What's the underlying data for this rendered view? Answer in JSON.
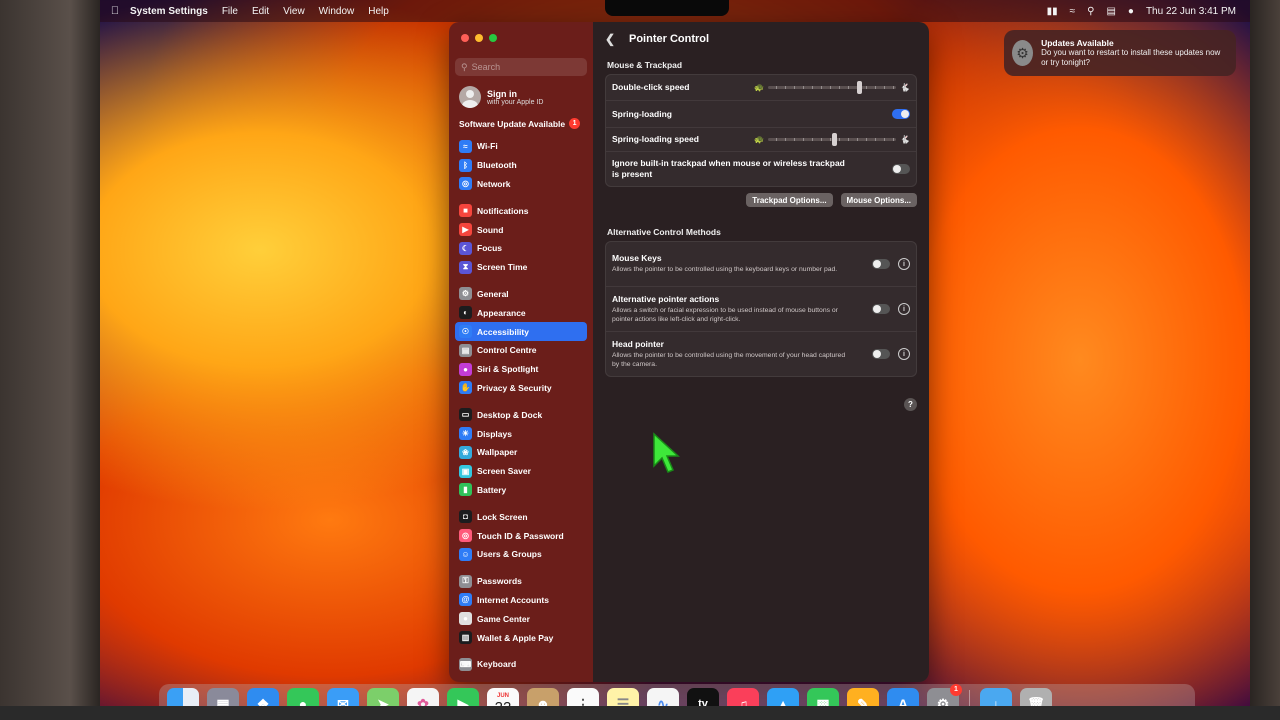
{
  "menubar": {
    "app_name": "System Settings",
    "menus": [
      "File",
      "Edit",
      "View",
      "Window",
      "Help"
    ],
    "datetime": "Thu 22 Jun  3:41 PM"
  },
  "sidebar": {
    "search_placeholder": "Search",
    "signin_title": "Sign in",
    "signin_subtitle": "with your Apple ID",
    "software_update": "Software Update Available",
    "software_update_badge": "1",
    "groups": [
      [
        {
          "label": "Wi-Fi",
          "icon": "wifi-icon",
          "color": "#2f7cf6"
        },
        {
          "label": "Bluetooth",
          "icon": "bluetooth-icon",
          "color": "#2f7cf6"
        },
        {
          "label": "Network",
          "icon": "globe-icon",
          "color": "#2f7cf6"
        }
      ],
      [
        {
          "label": "Notifications",
          "icon": "bell-icon",
          "color": "#f5453d"
        },
        {
          "label": "Sound",
          "icon": "speaker-icon",
          "color": "#f5453d"
        },
        {
          "label": "Focus",
          "icon": "moon-icon",
          "color": "#5b55d6"
        },
        {
          "label": "Screen Time",
          "icon": "hourglass-icon",
          "color": "#5b55d6"
        }
      ],
      [
        {
          "label": "General",
          "icon": "gear-icon",
          "color": "#8e8e93"
        },
        {
          "label": "Appearance",
          "icon": "appearance-icon",
          "color": "#1c1c1e"
        },
        {
          "label": "Accessibility",
          "icon": "accessibility-icon",
          "color": "#2f7cf6",
          "selected": true
        },
        {
          "label": "Control Centre",
          "icon": "control-centre-icon",
          "color": "#8e8e93"
        },
        {
          "label": "Siri & Spotlight",
          "icon": "siri-icon",
          "color": "#c33cd6"
        },
        {
          "label": "Privacy & Security",
          "icon": "hand-icon",
          "color": "#2f7cf6"
        }
      ],
      [
        {
          "label": "Desktop & Dock",
          "icon": "dock-icon",
          "color": "#1c1c1e"
        },
        {
          "label": "Displays",
          "icon": "sun-icon",
          "color": "#2f7cf6"
        },
        {
          "label": "Wallpaper",
          "icon": "wallpaper-icon",
          "color": "#34aadc"
        },
        {
          "label": "Screen Saver",
          "icon": "screensaver-icon",
          "color": "#34c8e0"
        },
        {
          "label": "Battery",
          "icon": "battery-icon",
          "color": "#30c25a"
        }
      ],
      [
        {
          "label": "Lock Screen",
          "icon": "lock-icon",
          "color": "#1c1c1e"
        },
        {
          "label": "Touch ID & Password",
          "icon": "fingerprint-icon",
          "color": "#ff5a7a"
        },
        {
          "label": "Users & Groups",
          "icon": "users-icon",
          "color": "#2f7cf6"
        }
      ],
      [
        {
          "label": "Passwords",
          "icon": "key-icon",
          "color": "#8e8e93"
        },
        {
          "label": "Internet Accounts",
          "icon": "at-icon",
          "color": "#2f7cf6"
        },
        {
          "label": "Game Center",
          "icon": "game-center-icon",
          "color": "#e0e0e0"
        },
        {
          "label": "Wallet & Apple Pay",
          "icon": "wallet-icon",
          "color": "#1c1c1e"
        }
      ],
      [
        {
          "label": "Keyboard",
          "icon": "keyboard-icon",
          "color": "#8e8e93"
        }
      ]
    ]
  },
  "content": {
    "title": "Pointer Control",
    "section1_title": "Mouse & Trackpad",
    "double_click_label": "Double-click speed",
    "double_click_value": 0.72,
    "spring_loading_label": "Spring-loading",
    "spring_loading_on": true,
    "spring_loading_speed_label": "Spring-loading speed",
    "spring_loading_speed_value": 0.52,
    "ignore_trackpad_label": "Ignore built-in trackpad when mouse or wireless trackpad is present",
    "ignore_trackpad_on": false,
    "trackpad_options_label": "Trackpad Options...",
    "mouse_options_label": "Mouse Options...",
    "section2_title": "Alternative Control Methods",
    "mouse_keys_label": "Mouse Keys",
    "mouse_keys_desc": "Allows the pointer to be controlled using the keyboard keys or number pad.",
    "mouse_keys_on": false,
    "alt_pointer_label": "Alternative pointer actions",
    "alt_pointer_desc": "Allows a switch or facial expression to be used instead of mouse buttons or pointer actions like left-click and right-click.",
    "alt_pointer_on": false,
    "head_pointer_label": "Head pointer",
    "head_pointer_desc": "Allows the pointer to be controlled using the movement of your head captured by the camera.",
    "head_pointer_on": false,
    "help_label": "?"
  },
  "notification": {
    "title": "Updates Available",
    "body": "Do you want to restart to install these updates now or try tonight?"
  },
  "dock": {
    "calendar_month": "JUN",
    "calendar_day": "22",
    "tv_label": "tv",
    "settings_badge": "1"
  }
}
